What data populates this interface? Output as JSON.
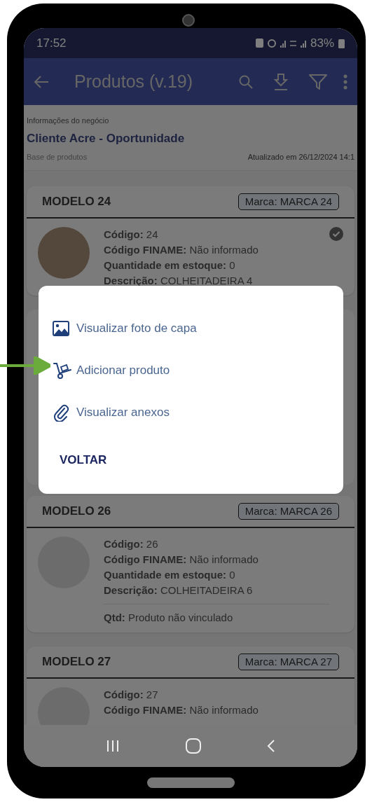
{
  "status_bar": {
    "time": "17:52",
    "battery": "83%"
  },
  "app_bar": {
    "title": "Produtos (v.19)"
  },
  "business": {
    "label": "Informações do negócio",
    "client": "Cliente Acre - Oportunidade",
    "base": "Base de produtos",
    "updated": "Atualizado em 26/12/2024 14:1"
  },
  "products": [
    {
      "model": "MODELO 24",
      "brand": "Marca: MARCA 24",
      "has_photo": true,
      "checked": true,
      "fields": [
        "**Código:** 24",
        "**Código FINAME:** Não informado",
        "**Quantidade em estoque:** 0",
        "**Descrição:** COLHEITADEIRA 4"
      ]
    },
    {
      "model": "MODELO 26",
      "brand": "Marca: MARCA 26",
      "has_photo": false,
      "checked": false,
      "fields": [
        "**Código:** 26",
        "**Código FINAME:** Não informado",
        "**Quantidade em estoque:** 0",
        "**Descrição:** COLHEITADEIRA 6"
      ],
      "footer": "**Qtd:** Produto não vinculado"
    },
    {
      "model": "MODELO 27",
      "brand": "Marca: MARCA 27",
      "has_photo": false,
      "checked": false,
      "fields": [
        "**Código:** 27",
        "**Código FINAME:** Não informado"
      ]
    }
  ],
  "dialog": {
    "items": [
      {
        "kind": "image",
        "label": "Visualizar foto de capa",
        "highlighted": false
      },
      {
        "kind": "cart",
        "label": "Adicionar produto",
        "highlighted": true
      },
      {
        "kind": "clip",
        "label": "Visualizar anexos",
        "highlighted": false
      }
    ],
    "button": "VOLTAR"
  }
}
